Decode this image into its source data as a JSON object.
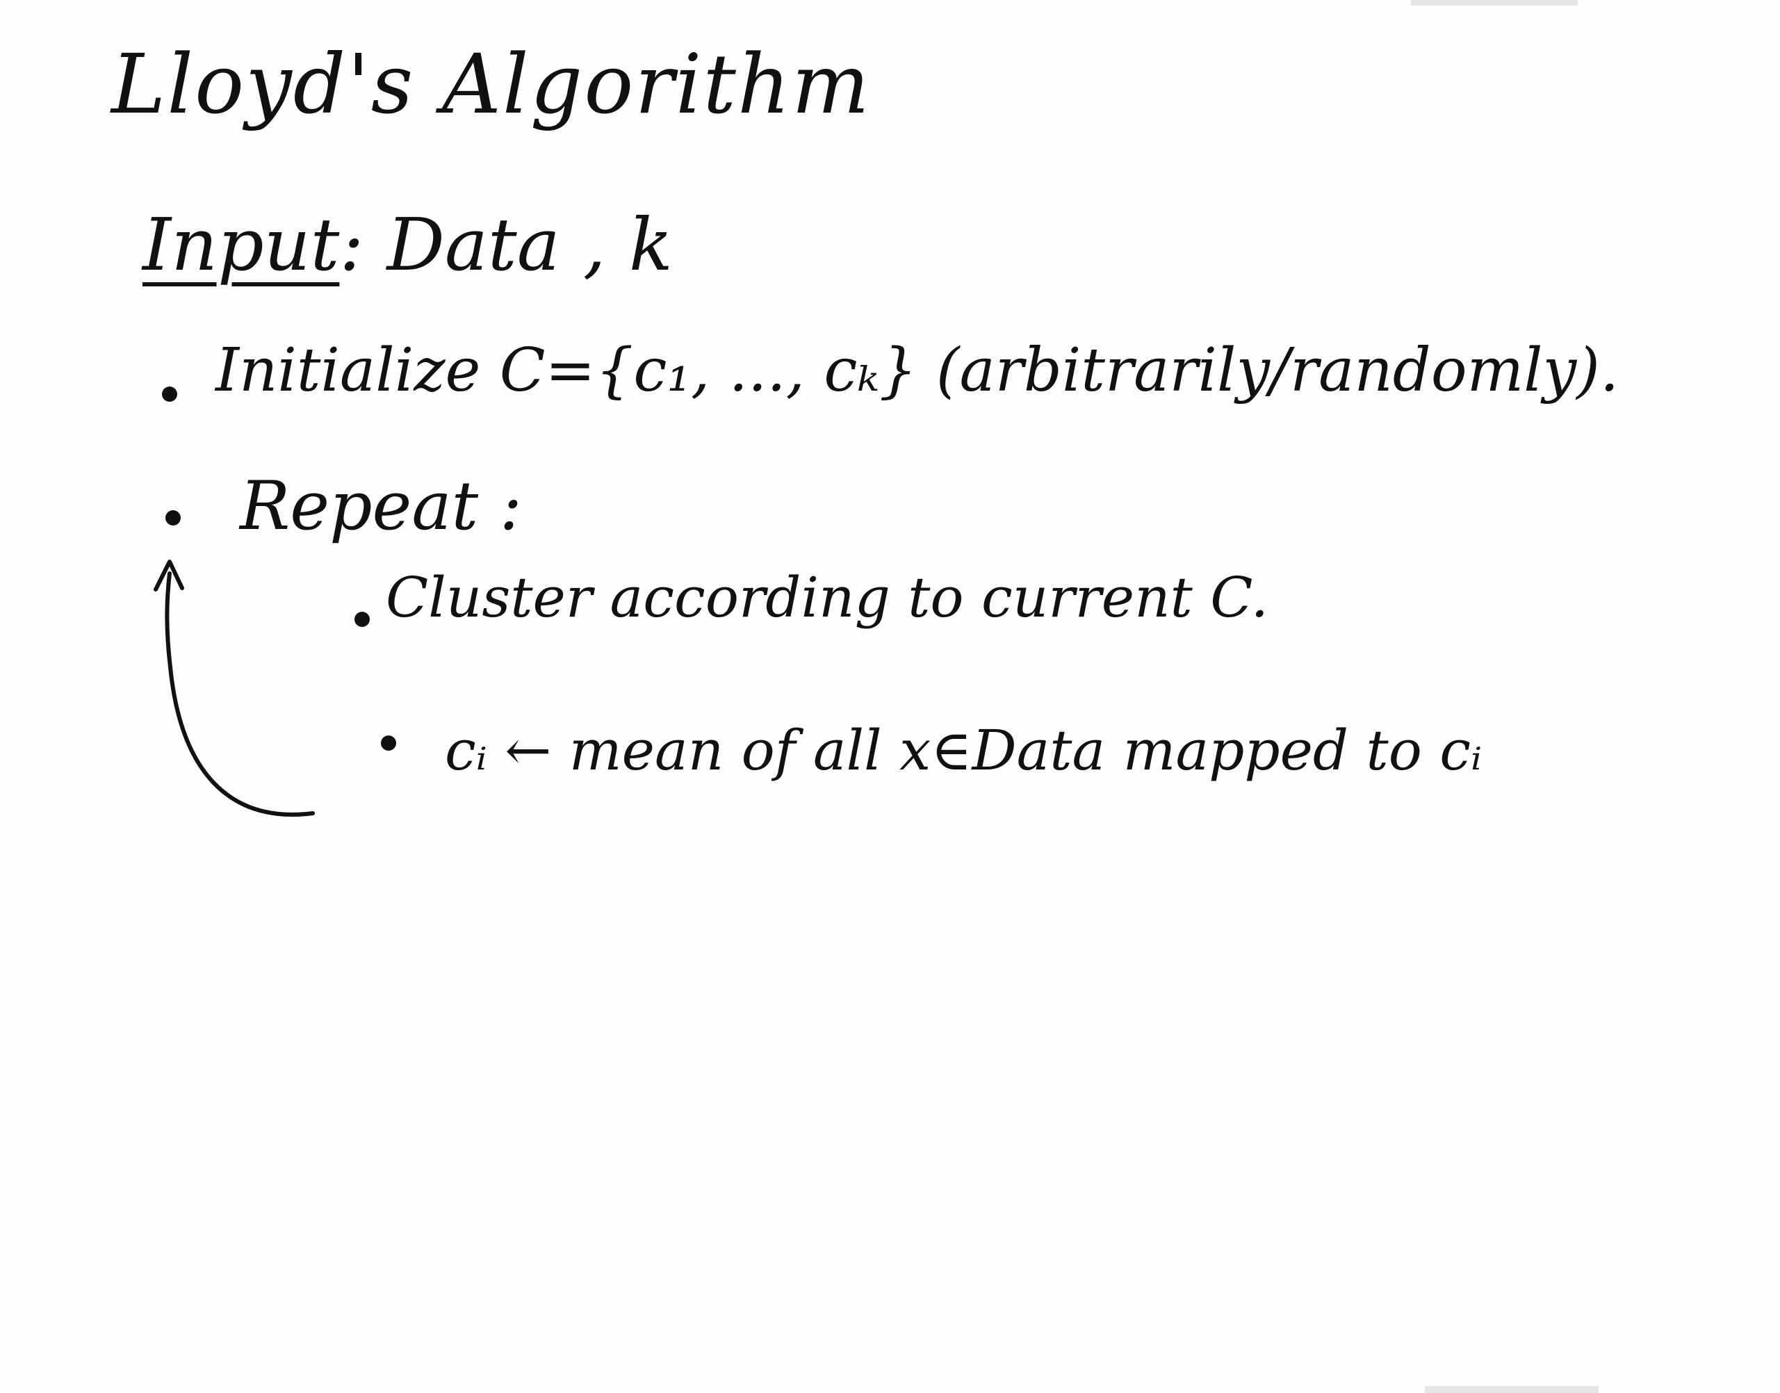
{
  "board": {
    "title": "Lloyd's Algorithm",
    "input_label": "Input",
    "input_value": ": Data , k",
    "steps": [
      {
        "text": "Initialize C={c₁, ..., cₖ} (arbitrarily/randomly)."
      },
      {
        "text": "Repeat :"
      }
    ],
    "substeps": [
      {
        "text": "Cluster according to current C."
      },
      {
        "text": "cᵢ ← mean of all x∈Data mapped to cᵢ"
      }
    ]
  },
  "colors": {
    "ink": "#111111",
    "background": "#ffffff"
  }
}
